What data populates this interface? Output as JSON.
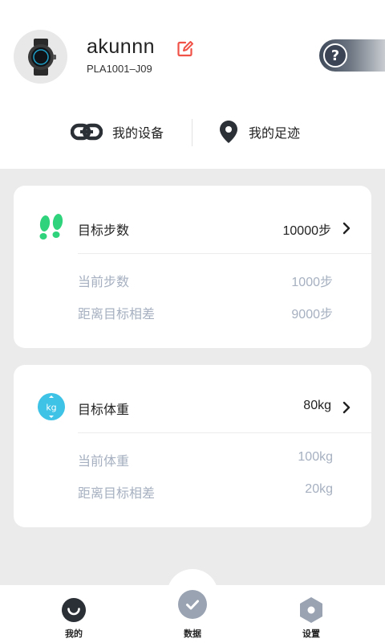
{
  "profile": {
    "username": "akunnn",
    "device_id": "PLA1001–J09"
  },
  "quick_links": {
    "devices_label": "我的设备",
    "tracks_label": "我的足迹"
  },
  "steps_card": {
    "title": "目标步数",
    "goal_value": "10000步",
    "current_label": "当前步数",
    "current_value": "1000步",
    "diff_label": "距离目标相差",
    "diff_value": "9000步"
  },
  "weight_card": {
    "title": "目标体重",
    "goal_value": "80kg",
    "current_label": "当前体重",
    "current_value": "100kg",
    "diff_label": "距离目标相差",
    "diff_value": "20kg",
    "icon_text": "kg"
  },
  "bottom_nav": {
    "items": [
      {
        "label": "我的",
        "icon": "smile-icon"
      },
      {
        "label": "数据",
        "icon": "check-circle-icon"
      },
      {
        "label": "设置",
        "icon": "hexagon-gear-icon"
      }
    ]
  },
  "colors": {
    "accent_green": "#2fd37b",
    "accent_cyan": "#3ec3e6",
    "edit_red": "#f05248",
    "muted_text": "#a6b0c0"
  }
}
